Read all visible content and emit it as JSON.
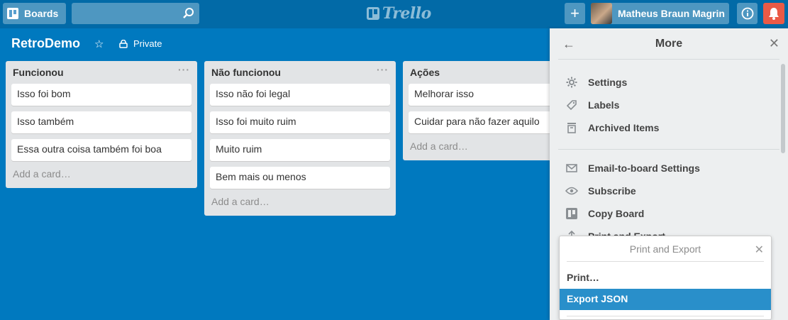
{
  "header": {
    "boards_label": "Boards",
    "search_placeholder": "",
    "logo_text": "Trello",
    "user_name": "Matheus Braun Magrin"
  },
  "board": {
    "title": "RetroDemo",
    "visibility": "Private"
  },
  "lists": [
    {
      "title": "Funcionou",
      "cards": [
        "Isso foi bom",
        "Isso também",
        "Essa outra coisa também foi boa"
      ],
      "add_card": "Add a card…"
    },
    {
      "title": "Não funcionou",
      "cards": [
        "Isso não foi legal",
        "Isso foi muito ruim",
        "Muito ruim",
        "Bem mais ou menos"
      ],
      "add_card": "Add a card…"
    },
    {
      "title": "Ações",
      "cards": [
        "Melhorar isso",
        "Cuidar para não fazer aquilo"
      ],
      "add_card": "Add a card…"
    }
  ],
  "sidebar": {
    "title": "More",
    "items": [
      {
        "label": "Settings",
        "icon": "gear-icon"
      },
      {
        "label": "Labels",
        "icon": "tag-icon"
      },
      {
        "label": "Archived Items",
        "icon": "archive-icon"
      },
      {
        "label": "Email-to-board Settings",
        "icon": "email-icon"
      },
      {
        "label": "Subscribe",
        "icon": "eye-icon"
      },
      {
        "label": "Copy Board",
        "icon": "board-icon"
      },
      {
        "label": "Print and Export",
        "icon": "share-icon"
      }
    ]
  },
  "popover": {
    "title": "Print and Export",
    "items": [
      "Print…",
      "Export JSON"
    ]
  },
  "colors": {
    "board_bg": "#0079bf",
    "header_bg": "#026aa7",
    "notification": "#eb5a46",
    "highlight": "#298fca"
  }
}
